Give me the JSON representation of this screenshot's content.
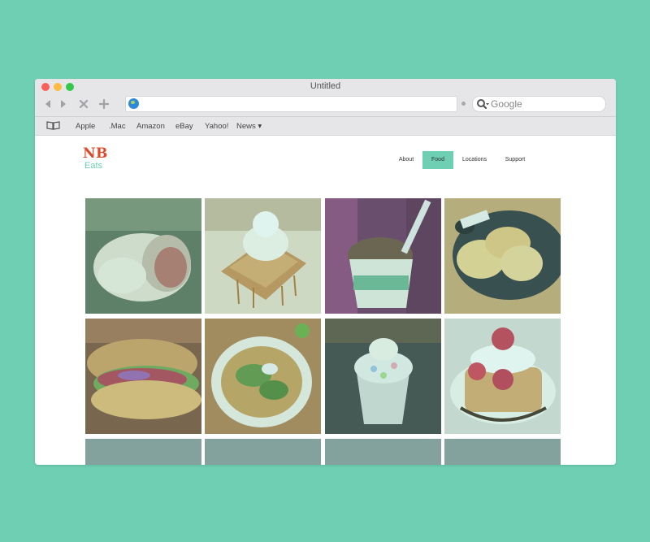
{
  "browser": {
    "window_title": "Untitled",
    "search_placeholder": "Google",
    "bookmarks": [
      "Apple",
      ".Mac",
      "Amazon",
      "eBay",
      "Yahoo!",
      "News ▾"
    ]
  },
  "site": {
    "logo_primary": "NB",
    "logo_secondary": "Eats",
    "nav": [
      "About",
      "Food",
      "Locations",
      "Support"
    ],
    "active_nav": "Food"
  },
  "gallery": {
    "tiles": [
      {
        "subject": "wrap-sandwich"
      },
      {
        "subject": "honey-toast"
      },
      {
        "subject": "ice-cream-cup"
      },
      {
        "subject": "pancakes"
      },
      {
        "subject": "sub-sandwich"
      },
      {
        "subject": "pho-soup"
      },
      {
        "subject": "shaved-ice-dessert"
      },
      {
        "subject": "strawberry-waffle"
      }
    ]
  },
  "colors": {
    "background": "#6ecfb2",
    "accent": "#6ecfb2",
    "logo_red": "#e0482a"
  }
}
